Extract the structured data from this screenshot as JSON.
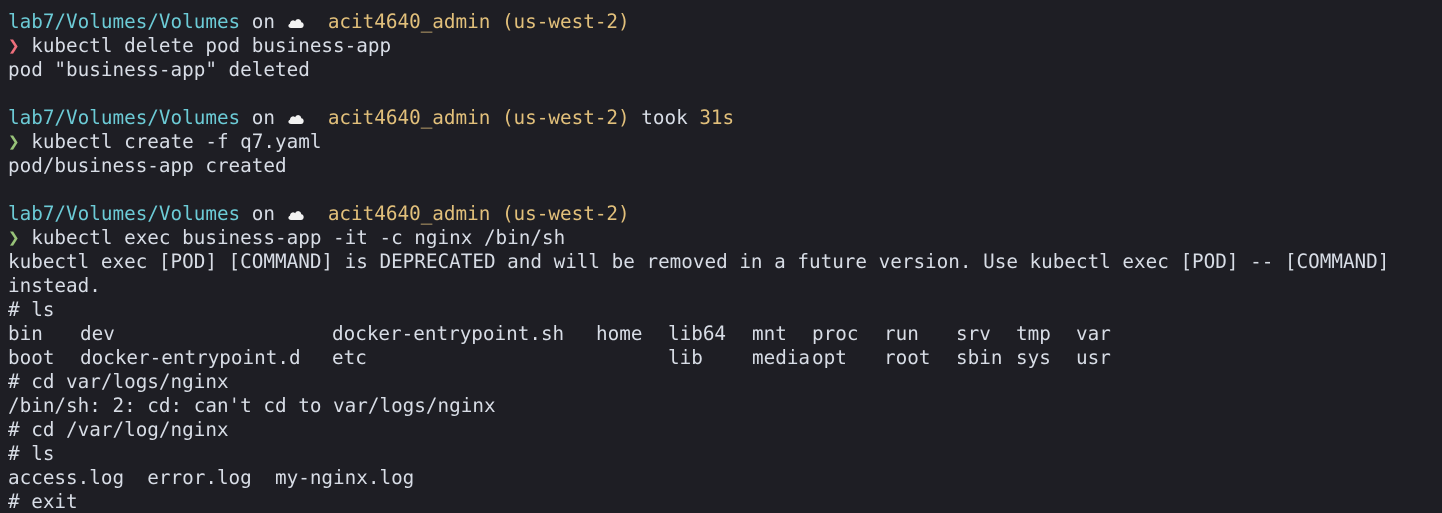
{
  "prompt": {
    "path": "lab7/Volumes/Volumes",
    "on": "on",
    "aws_profile": "acit4640_admin (us-west-2)",
    "took_label": "took",
    "took_value": "31s",
    "arrow": "❯",
    "cloud_icon": "cloud-icon"
  },
  "colors": {
    "background": "#1e1e24",
    "text": "#d8dde6",
    "path": "#6ccbd6",
    "aws": "#e2c07b",
    "error_arrow": "#ef6f7c",
    "ok_arrow": "#98c379"
  },
  "blocks": [
    {
      "command": "kubectl delete pod business-app",
      "output": [
        "pod \"business-app\" deleted"
      ]
    },
    {
      "command": "kubectl create -f q7.yaml",
      "output": [
        "pod/business-app created"
      ]
    },
    {
      "command": "kubectl exec business-app -it -c nginx /bin/sh",
      "output": [
        "kubectl exec [POD] [COMMAND] is DEPRECATED and will be removed in a future version. Use kubectl exec [POD] -- [COMMAND]",
        "instead.",
        "# ls"
      ]
    }
  ],
  "ls_root": {
    "row1": [
      "bin",
      "dev",
      "docker-entrypoint.sh",
      "home",
      "lib64",
      "mnt",
      "proc",
      "run",
      "srv",
      "tmp",
      "var"
    ],
    "row2": [
      "boot",
      "docker-entrypoint.d",
      "etc",
      "",
      "lib",
      "media",
      "opt",
      "root",
      "sbin",
      "sys",
      "usr"
    ]
  },
  "shell_session": [
    "# cd var/logs/nginx",
    "/bin/sh: 2: cd: can't cd to var/logs/nginx",
    "# cd /var/log/nginx",
    "# ls",
    "access.log  error.log  my-nginx.log",
    "# exit"
  ]
}
